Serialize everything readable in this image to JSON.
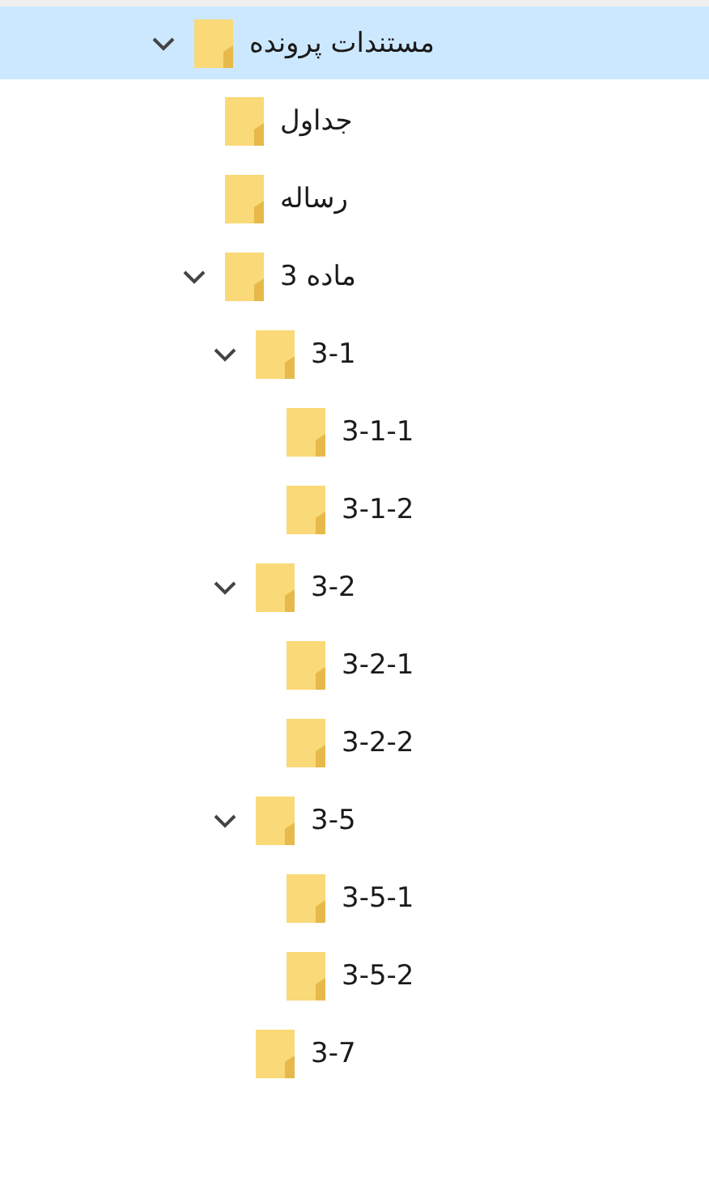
{
  "tree": [
    {
      "label": "مستندات پرونده",
      "selected": true,
      "expanded": true,
      "children": [
        {
          "label": "جداول",
          "selected": false
        },
        {
          "label": "رساله",
          "selected": false
        },
        {
          "label": "ماده 3",
          "selected": false,
          "expanded": true,
          "children": [
            {
              "label": "3-1",
              "selected": false,
              "expanded": true,
              "children": [
                {
                  "label": "3-1-1",
                  "selected": false
                },
                {
                  "label": "3-1-2",
                  "selected": false
                }
              ]
            },
            {
              "label": "3-2",
              "selected": false,
              "expanded": true,
              "children": [
                {
                  "label": "3-2-1",
                  "selected": false
                },
                {
                  "label": "3-2-2",
                  "selected": false
                }
              ]
            },
            {
              "label": "3-5",
              "selected": false,
              "expanded": true,
              "children": [
                {
                  "label": "3-5-1",
                  "selected": false
                },
                {
                  "label": "3-5-2",
                  "selected": false
                }
              ]
            },
            {
              "label": "3-7",
              "selected": false
            }
          ]
        }
      ]
    }
  ]
}
